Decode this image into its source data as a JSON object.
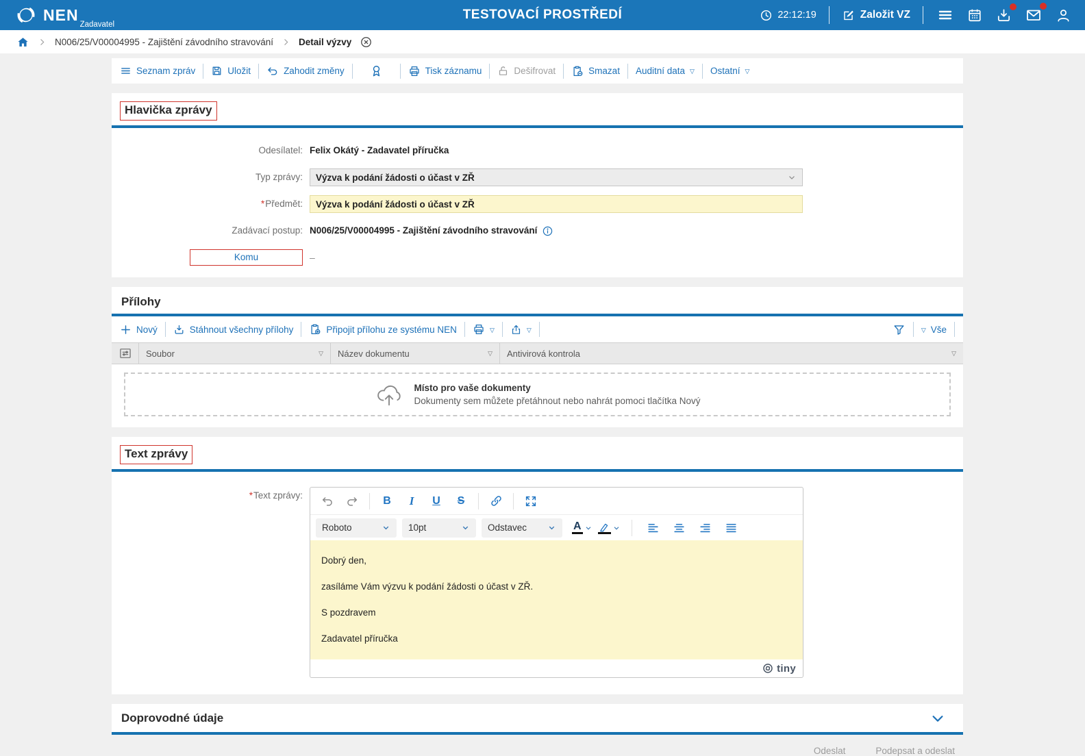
{
  "topbar": {
    "brand": "NEN",
    "brand_sub": "Zadavatel",
    "title": "TESTOVACÍ PROSTŘEDÍ",
    "time": "22:12:19",
    "create_label": "Založit VZ",
    "icons": [
      "clock-icon",
      "edit-icon",
      "menu-icon",
      "calendar-icon",
      "downloads-icon",
      "mail-icon",
      "user-icon"
    ],
    "badge_color": "#d93025"
  },
  "breadcrumb": {
    "procedure": "N006/25/V00004995 - Zajištění závodního stravování",
    "current": "Detail výzvy"
  },
  "toolbar": {
    "items": [
      {
        "label": "Seznam zpráv",
        "icon": "list-icon"
      },
      {
        "label": "Uložit",
        "icon": "save-icon"
      },
      {
        "label": "Zahodit změny",
        "icon": "undo-icon"
      },
      {
        "label": "",
        "icon": "ribbon-icon"
      },
      {
        "label": "Tisk záznamu",
        "icon": "printer-icon"
      },
      {
        "label": "Dešifrovat",
        "icon": "unlock-icon",
        "disabled": true
      },
      {
        "label": "Smazat",
        "icon": "delete-document-icon"
      },
      {
        "label": "Auditní data",
        "dropdown": "▽"
      },
      {
        "label": "Ostatní",
        "dropdown": "▽"
      }
    ]
  },
  "header_section": {
    "title": "Hlavička zprávy",
    "sender_label": "Odesílatel:",
    "sender_value": "Felix Okátý - Zadavatel příručka",
    "type_label": "Typ zprávy:",
    "type_value": "Výzva k podání žádosti o účast v ZŘ",
    "subject_required": "*",
    "subject_label": "Předmět:",
    "subject_value": "Výzva k podání žádosti o účast v ZŘ",
    "procedure_label": "Zadávací postup:",
    "procedure_value": "N006/25/V00004995 - Zajištění závodního stravování",
    "recipient_label": "Komu",
    "recipient_value": "–"
  },
  "attachments_section": {
    "title": "Přílohy",
    "new_label": "Nový",
    "download_all_label": "Stáhnout všechny přílohy",
    "attach_from_nen_label": "Připojit přílohu ze systému NEN",
    "print_dd": "▽",
    "share_dd": "▽",
    "all_dd": "▽",
    "all_label": "Vše",
    "table": {
      "col_soubor": "Soubor",
      "col_nazev": "Název dokumentu",
      "col_antivir": "Antivirová kontrola",
      "filter_mark": "▽"
    },
    "dropzone": {
      "title": "Místo pro vaše dokumenty",
      "subtitle": "Dokumenty sem můžete přetáhnout nebo nahrát pomoci tlačítka Nový"
    }
  },
  "message_section": {
    "title": "Text zprávy",
    "field_required": "*",
    "field_label": "Text zprávy:",
    "editor": {
      "font_name": "Roboto",
      "font_size": "10pt",
      "block_format": "Odstavec",
      "color_letter": "A",
      "paragraphs": [
        "Dobrý den,",
        "zasíláme Vám výzvu k podání žádosti o účast v ZŘ.",
        "S pozdravem",
        "Zadavatel příručka"
      ],
      "brand": "tiny"
    }
  },
  "details_section": {
    "title": "Doprovodné údaje"
  },
  "footer": {
    "send_label": "Odeslat",
    "sign_and_send_label": "Podepsat a odeslat"
  },
  "colors": {
    "accent_blue": "#1b76b9",
    "link_blue": "#1d71b8",
    "underline_blue": "#1672b0",
    "annotation_red": "#d0342c",
    "highlight_yellow": "#fcf6cd"
  }
}
